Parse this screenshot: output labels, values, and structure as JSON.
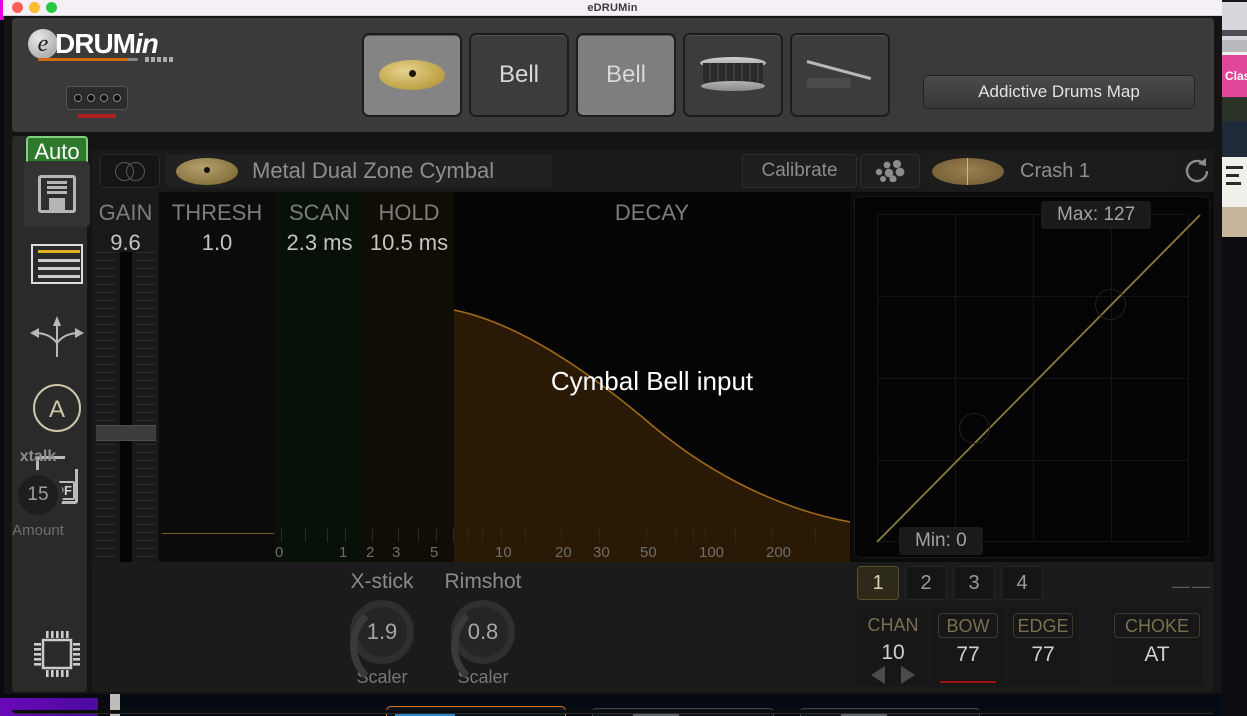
{
  "window": {
    "title": "eDRUMin",
    "traffic_lights": [
      "close",
      "minimize",
      "zoom"
    ]
  },
  "header": {
    "logo": {
      "e": "e",
      "text": "DRUM",
      "italic": "in"
    },
    "connector_pins": 4,
    "pads": [
      {
        "label": "",
        "icon": "cymbal-icon",
        "state": "selected"
      },
      {
        "label": "Bell",
        "icon": "",
        "state": "normal"
      },
      {
        "label": "Bell",
        "icon": "",
        "state": "lit"
      },
      {
        "label": "",
        "icon": "snare-drum-icon",
        "state": "normal"
      },
      {
        "label": "",
        "icon": "hihat-pedal-icon",
        "state": "normal"
      }
    ],
    "map_button": "Addictive Drums Map"
  },
  "sidebar": {
    "auto_badge": "Auto",
    "items": [
      {
        "name": "save-preset",
        "icon": "floppy-disk-icon"
      },
      {
        "name": "list-view",
        "icon": "list-icon"
      },
      {
        "name": "spread-routing",
        "icon": "arrows-spread-icon"
      },
      {
        "name": "about",
        "icon": "circle-a-icon"
      },
      {
        "name": "export-pdf",
        "icon": "pdf-icon"
      },
      {
        "name": "firmware",
        "icon": "chip-icon"
      }
    ]
  },
  "toolbar": {
    "link_icon": "link-circles-icon",
    "preset_name": "Metal Dual Zone Cymbal",
    "preset_icon": "cymbal-icon",
    "calibrate": "Calibrate",
    "dots_icon": "pad-dots-icon",
    "note_name": "Crash 1",
    "note_icon": "crash-cymbal-icon",
    "refresh_icon": "refresh-icon"
  },
  "parameters": [
    {
      "label": "GAIN",
      "value": "9.6"
    },
    {
      "label": "THRESH",
      "value": "1.0"
    },
    {
      "label": "SCAN",
      "value": "2.3 ms"
    },
    {
      "label": "HOLD",
      "value": "10.5 ms"
    },
    {
      "label": "DECAY",
      "value": ""
    }
  ],
  "scale_ticks": [
    "0",
    "1",
    "2",
    "3",
    "5",
    "10",
    "20",
    "30",
    "50",
    "100",
    "200"
  ],
  "overlay_label": "Cymbal Bell input",
  "velocity_curve": {
    "max_label": "Max: 127",
    "min_label": "Min: 0",
    "max_value": 127,
    "min_value": 0,
    "grid_divisions": 4
  },
  "knobs": [
    {
      "label": "X-stick",
      "value": "1.9",
      "sub": "Scaler"
    },
    {
      "label": "Rimshot",
      "value": "0.8",
      "sub": "Scaler"
    }
  ],
  "xtalk": {
    "title": "xtalk",
    "value": "15",
    "sub": "Amount"
  },
  "zone_tabs": [
    {
      "label": "1",
      "active": true
    },
    {
      "label": "2",
      "active": false
    },
    {
      "label": "3",
      "active": false
    },
    {
      "label": "4",
      "active": false
    }
  ],
  "dashes": "——",
  "midi": [
    {
      "header": "CHAN",
      "value": "10",
      "boxed": false,
      "has_arrows": true,
      "underline": false
    },
    {
      "header": "BOW",
      "value": "77",
      "boxed": true,
      "has_arrows": false,
      "underline": true
    },
    {
      "header": "EDGE",
      "value": "77",
      "boxed": true,
      "has_arrows": false,
      "underline": false
    },
    {
      "header": "CHOKE",
      "value": "AT",
      "boxed": true,
      "has_arrows": false,
      "underline": false
    }
  ],
  "background": {
    "pdf_label": "PDF",
    "pink_label": "Clas"
  },
  "colors": {
    "auto_green": "#2d7a2d",
    "accent_orange": "#d4690f",
    "curve_yellow": "#8a7d3a",
    "red_underline": "#a01010",
    "panel_dark": "#141414"
  }
}
